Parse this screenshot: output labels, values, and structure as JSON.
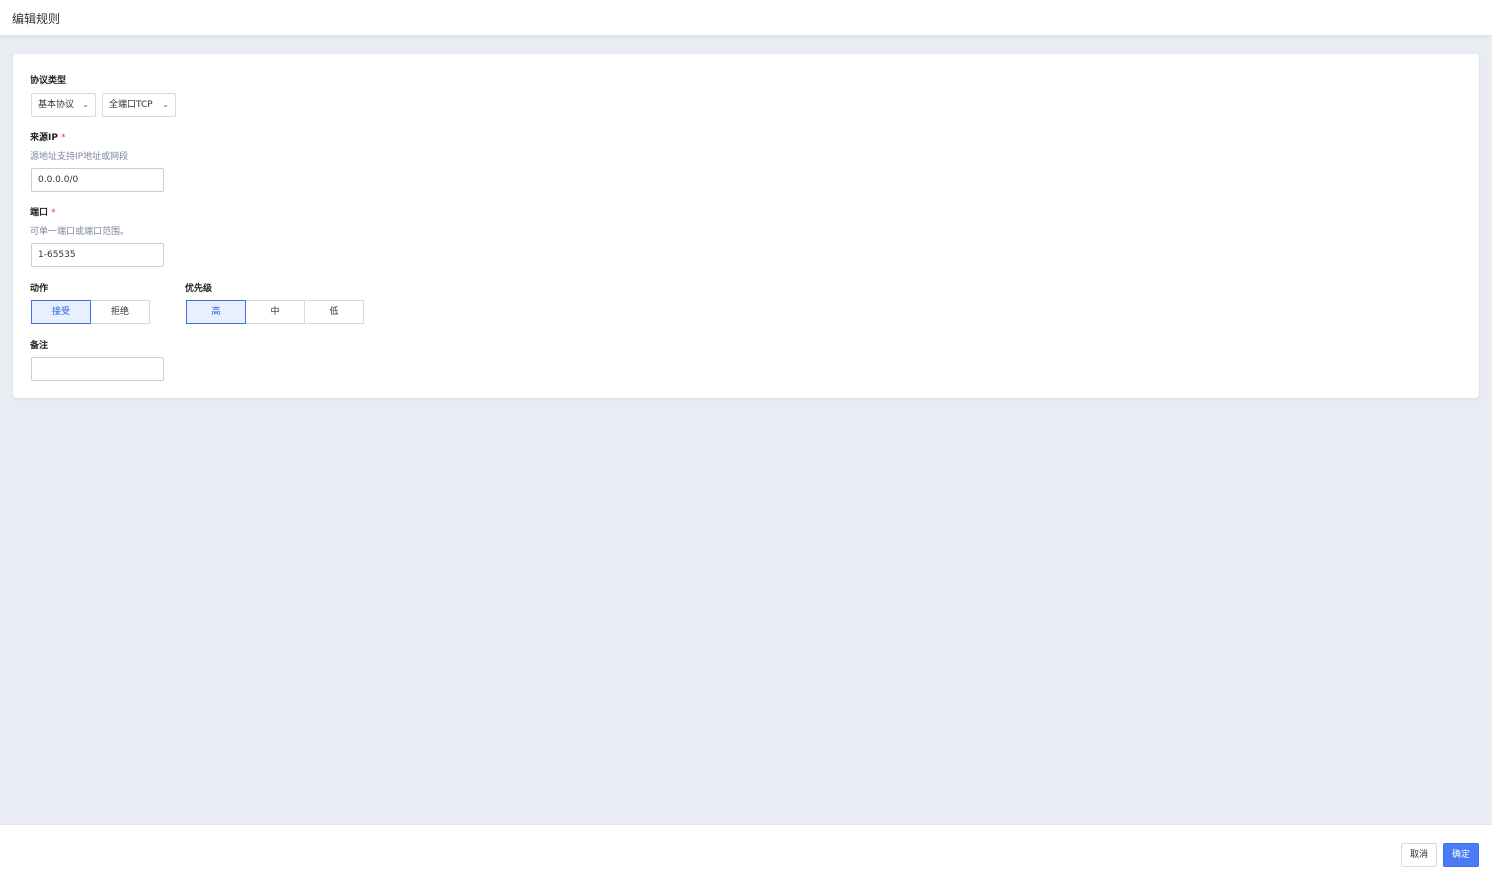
{
  "header": {
    "title": "编辑规则"
  },
  "form": {
    "protocol": {
      "label": "协议类型",
      "protocol_group": "基本协议",
      "protocol_value": "全端口TCP"
    },
    "source_ip": {
      "label": "来源IP",
      "required_mark": "*",
      "hint": "源地址支持IP地址或网段",
      "value": "0.0.0.0/0"
    },
    "port": {
      "label": "端口",
      "required_mark": "*",
      "hint": "可单一端口或端口范围。",
      "value": "1-65535"
    },
    "action": {
      "label": "动作",
      "options": [
        "接受",
        "拒绝"
      ],
      "selected": "接受"
    },
    "priority": {
      "label": "优先级",
      "options": [
        "高",
        "中",
        "低"
      ],
      "selected": "高"
    },
    "remark": {
      "label": "备注",
      "value": ""
    }
  },
  "footer": {
    "cancel_label": "取消",
    "confirm_label": "确定"
  },
  "colors": {
    "accent": "#3d6ef0",
    "background": "#e9ecf2",
    "required": "#e4393c"
  }
}
